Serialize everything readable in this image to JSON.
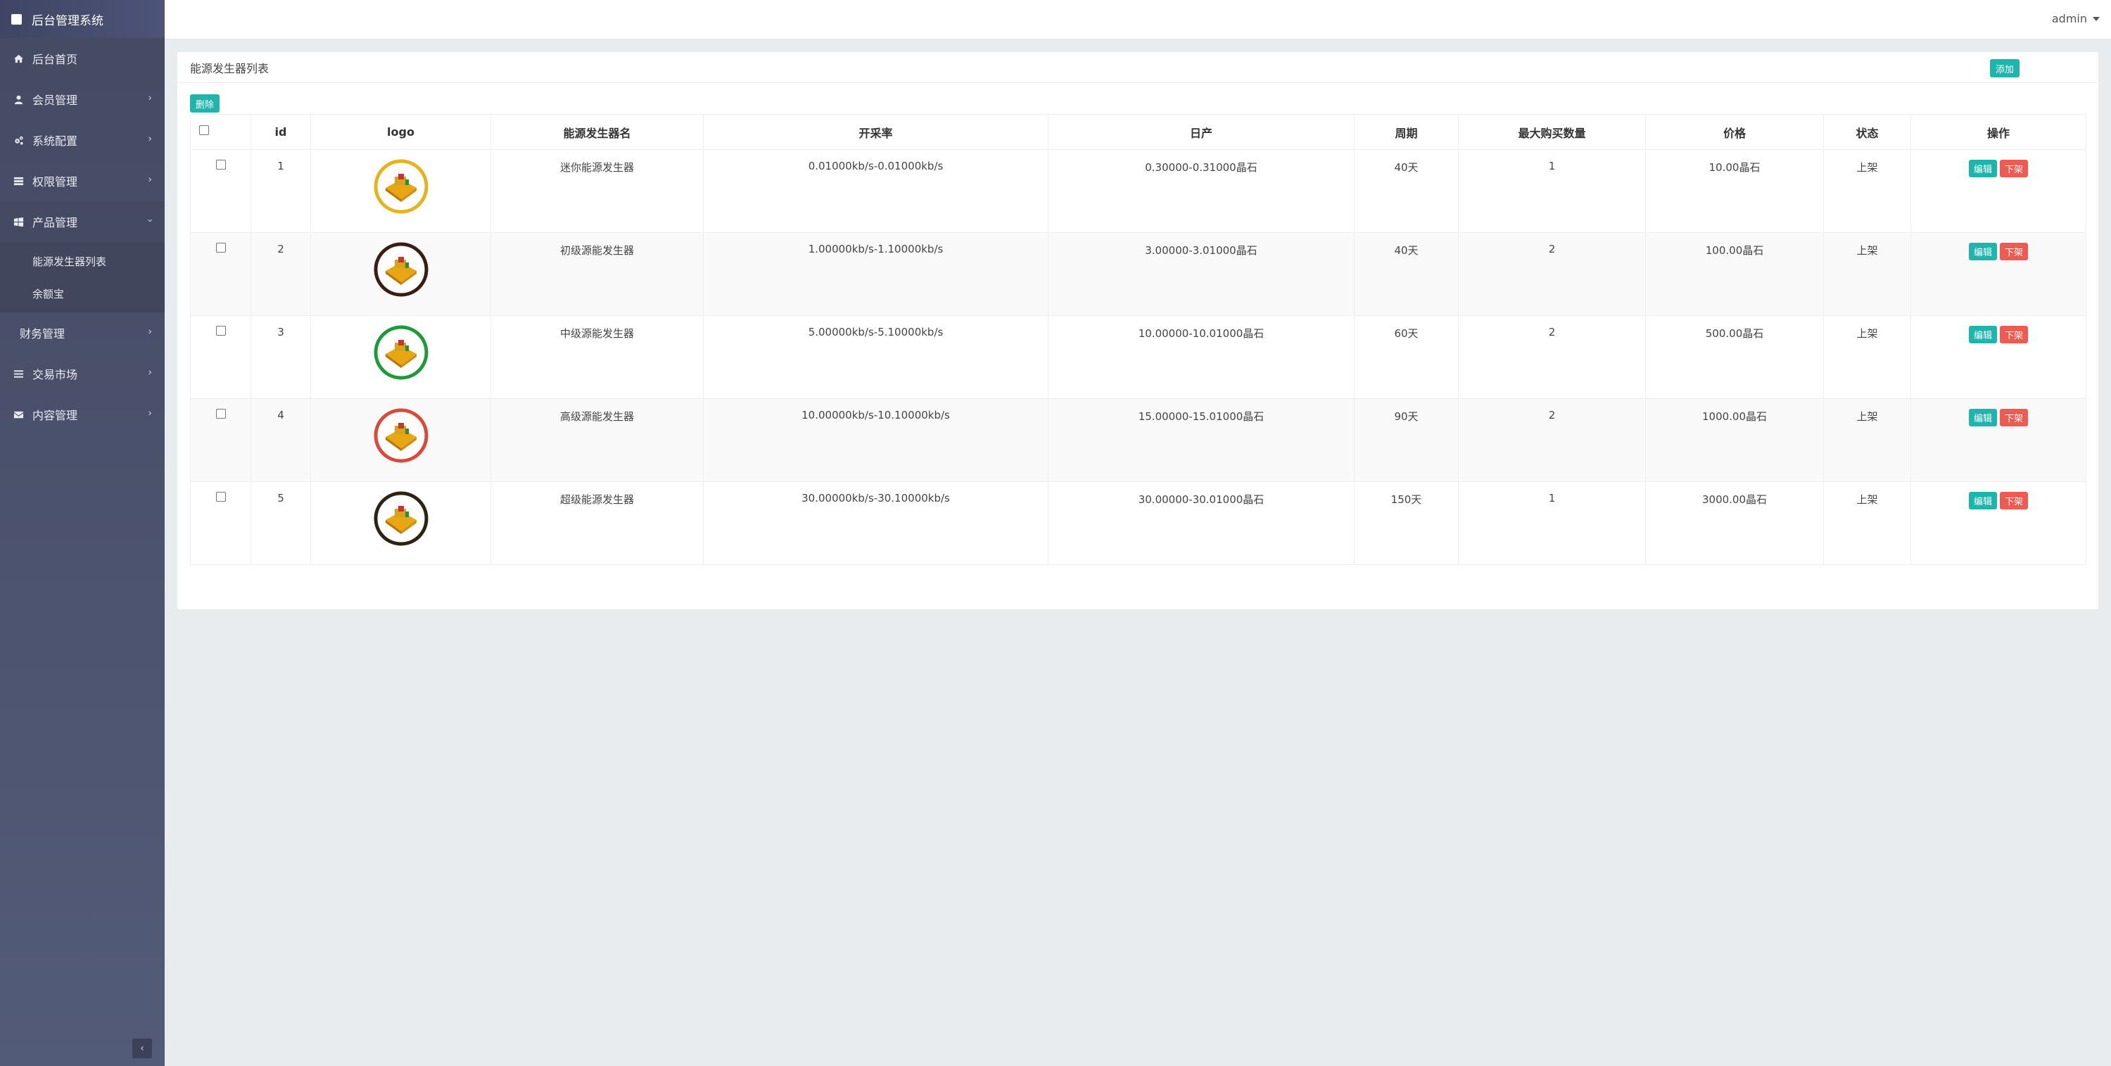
{
  "sidebar": {
    "brand": "后台管理系统",
    "items": [
      {
        "label": "后台首页",
        "icon": "home-icon",
        "has_children": false
      },
      {
        "label": "会员管理",
        "icon": "user-icon",
        "has_children": true
      },
      {
        "label": "系统配置",
        "icon": "gears-icon",
        "has_children": true
      },
      {
        "label": "权限管理",
        "icon": "list-icon",
        "has_children": true
      },
      {
        "label": "产品管理",
        "icon": "windows-icon",
        "has_children": true,
        "open": true,
        "children": [
          "能源发生器列表",
          "余额宝"
        ]
      },
      {
        "label": "财务管理",
        "icon": "",
        "has_children": true
      },
      {
        "label": "交易市场",
        "icon": "bars-icon",
        "has_children": true
      },
      {
        "label": "内容管理",
        "icon": "envelope-icon",
        "has_children": true
      }
    ],
    "collapse_glyph": "‹"
  },
  "topbar": {
    "user": "admin"
  },
  "panel": {
    "title": "能源发生器列表",
    "add_label": "添加",
    "delete_label": "删除"
  },
  "table": {
    "columns": [
      "",
      "id",
      "logo",
      "能源发生器名",
      "开采率",
      "日产",
      "周期",
      "最大购买数量",
      "价格",
      "状态",
      "操作"
    ],
    "edit_label": "编辑",
    "offshelf_label": "下架",
    "rows": [
      {
        "id": "1",
        "ring": "#e8b21c",
        "name": "迷你能源发生器",
        "rate": "0.01000kb/s-0.01000kb/s",
        "daily": "0.30000-0.31000晶石",
        "period": "40天",
        "max": "1",
        "price": "10.00晶石",
        "status": "上架"
      },
      {
        "id": "2",
        "ring": "#3a1d14",
        "name": "初级源能发生器",
        "rate": "1.00000kb/s-1.10000kb/s",
        "daily": "3.00000-3.01000晶石",
        "period": "40天",
        "max": "2",
        "price": "100.00晶石",
        "status": "上架"
      },
      {
        "id": "3",
        "ring": "#1f9a3a",
        "name": "中级源能发生器",
        "rate": "5.00000kb/s-5.10000kb/s",
        "daily": "10.00000-10.01000晶石",
        "period": "60天",
        "max": "2",
        "price": "500.00晶石",
        "status": "上架"
      },
      {
        "id": "4",
        "ring": "#d84a3a",
        "name": "高级源能发生器",
        "rate": "10.00000kb/s-10.10000kb/s",
        "daily": "15.00000-15.01000晶石",
        "period": "90天",
        "max": "2",
        "price": "1000.00晶石",
        "status": "上架"
      },
      {
        "id": "5",
        "ring": "#2b2412",
        "name": "超级能源发生器",
        "rate": "30.00000kb/s-30.10000kb/s",
        "daily": "30.00000-30.01000晶石",
        "period": "150天",
        "max": "1",
        "price": "3000.00晶石",
        "status": "上架"
      }
    ]
  }
}
